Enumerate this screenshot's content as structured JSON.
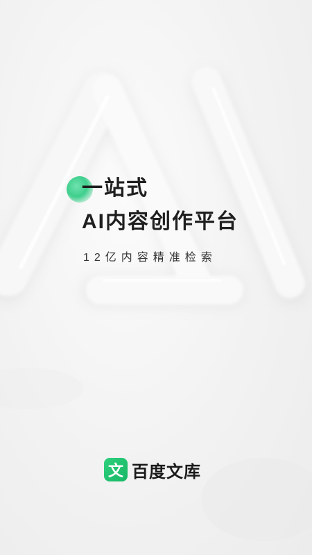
{
  "tagline": {
    "line1": "一站式",
    "line2": "AI内容创作平台",
    "subline": "12亿内容精准检索"
  },
  "brand": {
    "logo_char": "文",
    "name": "百度文库",
    "logo_color": "#22c472"
  },
  "accent_color": "#3fcf8d"
}
